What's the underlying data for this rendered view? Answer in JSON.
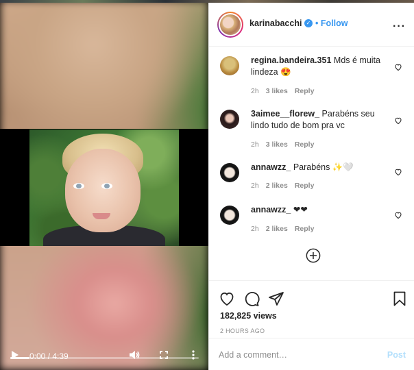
{
  "video": {
    "time_label": "0:00 / 4:39",
    "progress": 0.1
  },
  "header": {
    "username": "karinabacchi",
    "follow_label": "Follow",
    "separator": "•"
  },
  "comments": [
    {
      "user": "regina.bandeira.351",
      "text": "Mds é muita lindeza 😍",
      "time": "2h",
      "likes": "3 likes",
      "reply": "Reply"
    },
    {
      "user": "3aimee__florew_",
      "text": "Parabéns seu lindo tudo de bom pra vc",
      "time": "2h",
      "likes": "3 likes",
      "reply": "Reply"
    },
    {
      "user": "annawzz_",
      "text": "Parabéns ✨🤍",
      "time": "2h",
      "likes": "2 likes",
      "reply": "Reply"
    },
    {
      "user": "annawzz_",
      "text": "❤❤",
      "time": "2h",
      "likes": "2 likes",
      "reply": "Reply"
    }
  ],
  "post": {
    "views": "182,825 views",
    "ago": "2 HOURS AGO"
  },
  "add_comment": {
    "placeholder": "Add a comment…",
    "post_label": "Post"
  },
  "colors": {
    "link_blue": "#3897f0",
    "muted": "#8e8e8e",
    "post_disabled": "#b2dffc"
  },
  "icons": [
    "play-icon",
    "volume-icon",
    "fullscreen-icon",
    "more-vertical-icon",
    "verified-icon",
    "more-horizontal-icon",
    "heart-icon",
    "comment-icon",
    "share-icon",
    "bookmark-icon",
    "add-circle-icon"
  ]
}
